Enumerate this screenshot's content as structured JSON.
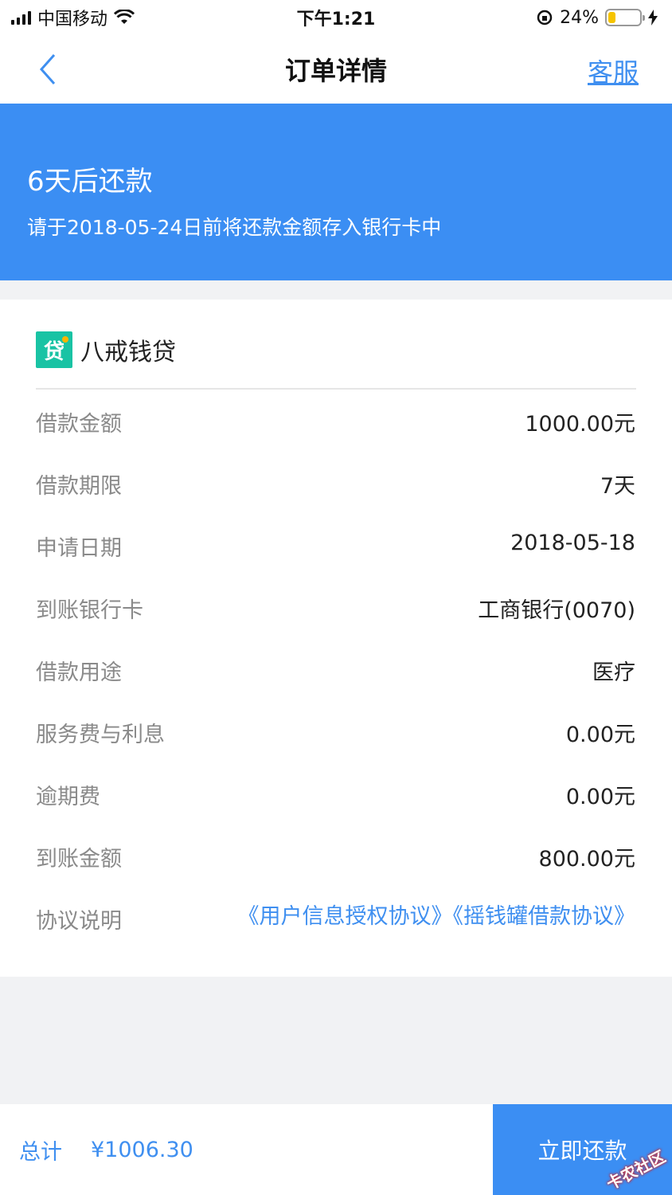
{
  "status_bar": {
    "carrier": "中国移动",
    "time": "下午1:21",
    "battery_percent": "24%",
    "battery_level": 0.24,
    "icons": [
      "signal-icon",
      "wifi-icon",
      "rotation-lock-icon",
      "battery-icon",
      "charging-icon"
    ]
  },
  "nav": {
    "title": "订单详情",
    "right_action": "客服",
    "back_icon": "chevron-left-icon"
  },
  "banner": {
    "title": "6天后还款",
    "subtitle": "请于2018-05-24日前将还款金额存入银行卡中",
    "color": "#3b8ef3"
  },
  "lender": {
    "logo_text": "贷",
    "name": "八戒钱贷",
    "logo_color": "#19c3a4"
  },
  "details": [
    {
      "label": "借款金额",
      "value": "1000.00元"
    },
    {
      "label": "借款期限",
      "value": "7天"
    },
    {
      "label": "申请日期",
      "value": "2018-05-18"
    },
    {
      "label": "到账银行卡",
      "value": "工商银行(0070)"
    },
    {
      "label": "借款用途",
      "value": "医疗"
    },
    {
      "label": "服务费与利息",
      "value": "0.00元"
    },
    {
      "label": "逾期费",
      "value": "0.00元"
    },
    {
      "label": "到账金额",
      "value": "800.00元"
    }
  ],
  "agreements": {
    "label": "协议说明",
    "links": [
      "《用户信息授权协议》",
      "《摇钱罐借款协议》"
    ]
  },
  "footer": {
    "total_label": "总计",
    "total_amount": "¥1006.30",
    "pay_button": "立即还款",
    "watermark": "卡农社区",
    "accent": "#3f8ff0"
  }
}
